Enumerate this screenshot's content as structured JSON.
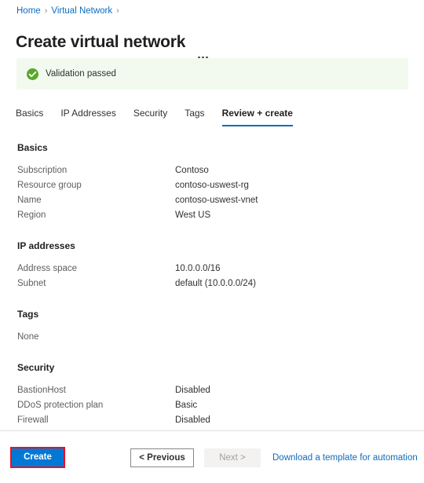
{
  "breadcrumb": {
    "items": [
      {
        "label": "Home"
      },
      {
        "label": "Virtual Network"
      }
    ],
    "separator": "›"
  },
  "header": {
    "title": "Create virtual network",
    "more_menu_label": "More"
  },
  "validation": {
    "icon": "check-circle-icon",
    "message": "Validation passed",
    "background_color": "#f2faf0",
    "icon_color": "#5aa72a"
  },
  "tabs": [
    {
      "label": "Basics",
      "active": false
    },
    {
      "label": "IP Addresses",
      "active": false
    },
    {
      "label": "Security",
      "active": false
    },
    {
      "label": "Tags",
      "active": false
    },
    {
      "label": "Review + create",
      "active": true
    }
  ],
  "sections": [
    {
      "title": "Basics",
      "rows": [
        {
          "label": "Subscription",
          "value": "Contoso"
        },
        {
          "label": "Resource group",
          "value": "contoso-uswest-rg"
        },
        {
          "label": "Name",
          "value": "contoso-uswest-vnet"
        },
        {
          "label": "Region",
          "value": "West US"
        }
      ]
    },
    {
      "title": "IP addresses",
      "rows": [
        {
          "label": "Address space",
          "value": "10.0.0.0/16"
        },
        {
          "label": "Subnet",
          "value": "default (10.0.0.0/24)"
        }
      ]
    },
    {
      "title": "Tags",
      "text": "None",
      "rows": []
    },
    {
      "title": "Security",
      "rows": [
        {
          "label": "BastionHost",
          "value": "Disabled"
        },
        {
          "label": "DDoS protection plan",
          "value": "Basic"
        },
        {
          "label": "Firewall",
          "value": "Disabled"
        }
      ]
    }
  ],
  "footer": {
    "create_label": "Create",
    "previous_label": "< Previous",
    "next_label": "Next >",
    "next_disabled": true,
    "download_template_label": "Download a template for automation",
    "create_highlight_color": "#e81123",
    "create_button_color": "#0078d4",
    "link_color": "#0f6cbd"
  }
}
